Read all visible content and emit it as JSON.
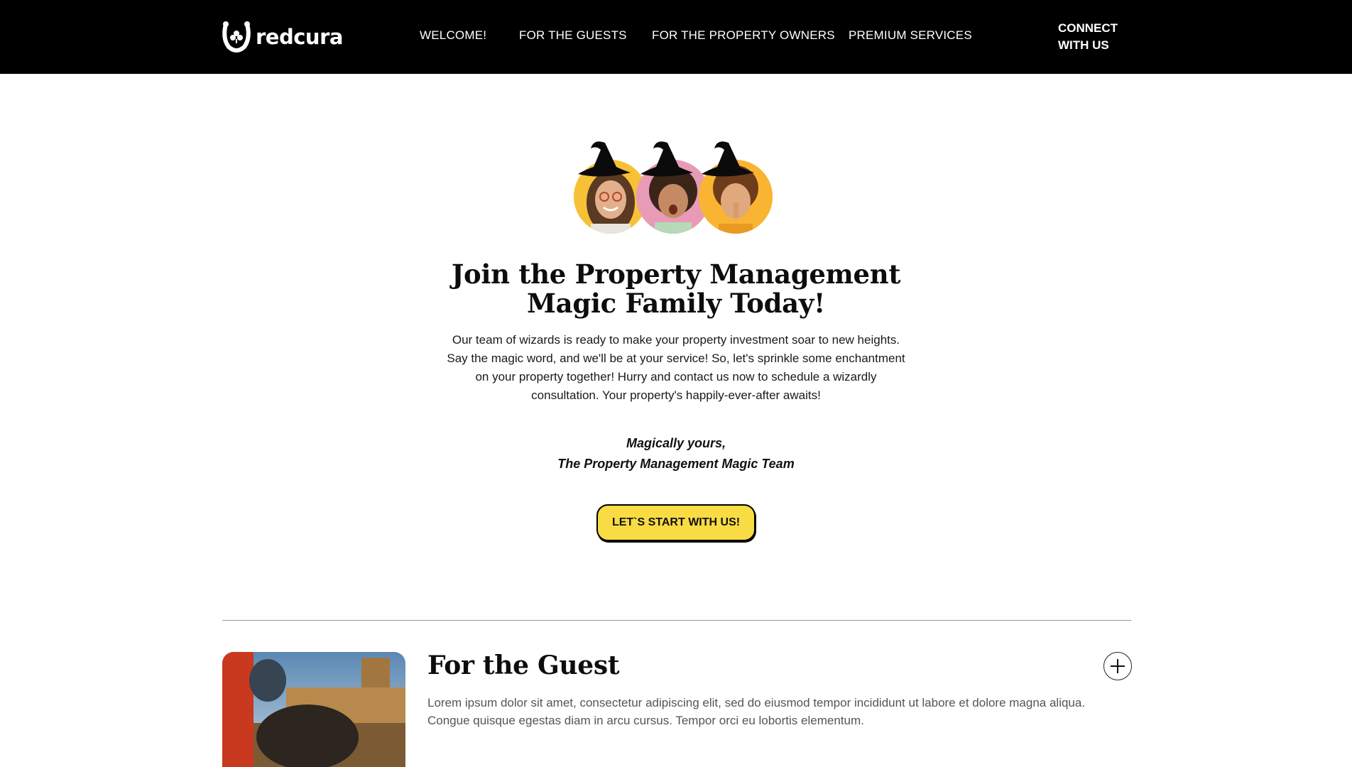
{
  "header": {
    "logo_text": "redcura",
    "nav": [
      {
        "label": "WELCOME!"
      },
      {
        "label": "FOR THE GUESTS"
      },
      {
        "label": "FOR THE PROPERTY OWNERS"
      },
      {
        "label": "PREMIUM SERVICES"
      }
    ],
    "connect_line1": "CONNECT",
    "connect_line2": "WITH US"
  },
  "hero": {
    "title_line1": "Join the Property Management",
    "title_line2": "Magic Family Today!",
    "body": "Our team of wizards is ready to make your property investment soar to new heights. Say the magic word, and we'll be at your service! So, let's sprinkle some enchantment on your property together! Hurry and contact us now to schedule a wizardly consultation. Your property's happily-ever-after awaits!",
    "signoff_line1": "Magically yours,",
    "signoff_line2": "The Property Management Magic Team",
    "cta_label": "LET`S START WITH US!"
  },
  "accordion": {
    "items": [
      {
        "title": "For the Guest",
        "body": "Lorem ipsum dolor sit amet, consectetur adipiscing elit, sed do eiusmod tempor incididunt ut labore et dolore magna aliqua. Congue quisque egestas diam in arcu cursus. Tempor orci eu lobortis elementum."
      }
    ]
  },
  "colors": {
    "header_bg": "#000000",
    "cta_bg": "#f9dc44",
    "avatar_1_bg": "#f7c137",
    "avatar_2_bg": "#e79bb6",
    "avatar_3_bg": "#f9b531"
  },
  "icons": {
    "logo": "horseshoe-clover-icon",
    "accordion_toggle": "plus-icon",
    "avatar_hats": "witch-hat-icon"
  }
}
